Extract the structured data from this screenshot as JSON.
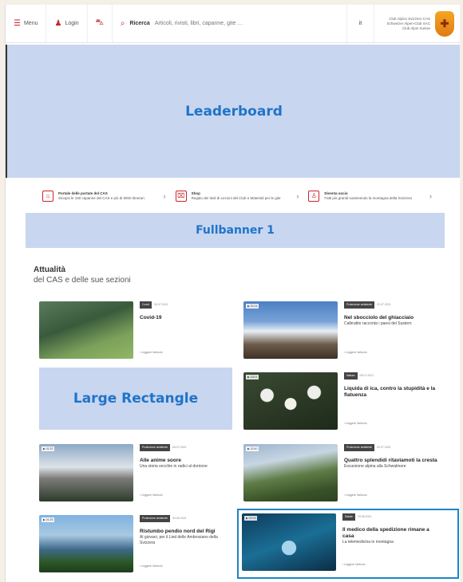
{
  "topnav": {
    "menu_label": "Menu",
    "login_label": "Login",
    "search_label": "Ricerca",
    "search_placeholder": "Articoli, rivisti, libri, capanne, gite …",
    "lang_label": "it",
    "brand_text": "Club Alpino Svizzero CAS Schweizer Alpen-Club SAC Club Alpin Suisse"
  },
  "ads": {
    "leaderboard": "Leaderboard",
    "fullbanner": "Fullbanner 1",
    "large_rectangle": "Large Rectangle"
  },
  "services": [
    {
      "title": "Portale delle portate del CAS",
      "desc": "Sinopsi le 150 capanne del CAS e più di 9000 itinerari."
    },
    {
      "title": "Shop",
      "desc": "Regalo dei titoli di Lezioni del Club e Materiali per le gite"
    },
    {
      "title": "Diventa socio",
      "desc": "Fatti più grandi sostenendo la montagna della Svizzera"
    }
  ],
  "news": {
    "title": "Attualità",
    "subtitle": "del CAS e delle sue sezioni",
    "more_label": "Leggere l'articolo",
    "items": [
      {
        "tag": "Covid",
        "date": "08.07.2021",
        "title": "Covid-19",
        "desc": "",
        "badge": ""
      },
      {
        "tag": "Protezione ambiente",
        "date": "22.07.2021",
        "title": "Nel sbocciolo del ghiacciaio",
        "desc": "Calbrattio racconta i paesi del Sustern",
        "badge": "▶ 02:14"
      },
      {
        "tag": "Natura",
        "date": "08.07.2021",
        "title": "Liquida di ica, contro la stupidità e la flatuenza",
        "desc": "",
        "badge": "▶ 03:01"
      },
      {
        "tag": "Protezione ambiente",
        "date": "06.07.2021",
        "title": "Alle anime soore",
        "desc": "Una storia vecchie in radici al dorrione",
        "badge": "▶ 01:32"
      },
      {
        "tag": "Protezione ambiente",
        "date": "02.07.2021",
        "title": "Quattro splendidi ritaviamoti la cresta",
        "desc": "Escursione alpina alla Schwalmere",
        "badge": "▶ 02:40"
      },
      {
        "tag": "Protezione ambiente",
        "date": "30.06.2021",
        "title": "Ristumbo pendio nord del Rigi",
        "desc": "Al giovani, per il Lied delle Ambrosiano della Svizzera",
        "badge": "▶ 01:25"
      },
      {
        "tag": "Salute",
        "date": "29.06.2021",
        "title": "Il medico della spedizione rimane a casa",
        "desc": "La telemedicina in montagna",
        "badge": "▶ 02:03"
      }
    ]
  },
  "colors": {
    "accent": "#c8262c",
    "ad_bg": "#c9d6ef",
    "ad_text": "#1f74c9",
    "highlight": "#1e84c8"
  }
}
